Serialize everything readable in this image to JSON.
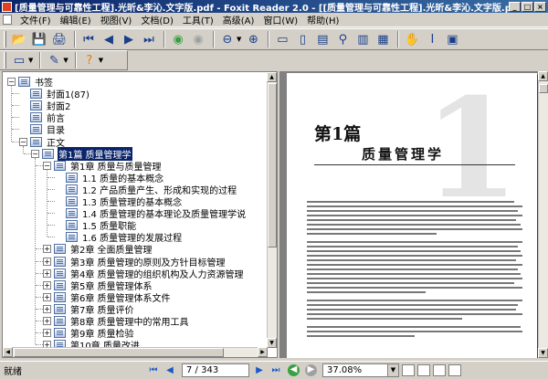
{
  "window": {
    "title": "[质量管理与可靠性工程].光昕&李沁.文字版.pdf - Foxit Reader 2.0 - [[质量管理与可靠性工程].光昕&李沁.文字版.pdf]",
    "buttons": {
      "minimize": "_",
      "maximize": "□",
      "close": "×"
    }
  },
  "menu": {
    "items": [
      {
        "label": "文件(F)"
      },
      {
        "label": "编辑(E)"
      },
      {
        "label": "视图(V)"
      },
      {
        "label": "文档(D)"
      },
      {
        "label": "工具(T)"
      },
      {
        "label": "高级(A)"
      },
      {
        "label": "窗口(W)"
      },
      {
        "label": "帮助(H)"
      }
    ]
  },
  "toolbar": {
    "icons": {
      "open": "folder-open-icon",
      "save": "save-icon",
      "print": "print-icon",
      "first": "first-page-icon",
      "prev": "previous-page-icon",
      "next": "next-page-icon",
      "last": "last-page-icon",
      "back": "back-icon",
      "forward": "forward-icon",
      "zoom_out": "zoom-out-icon",
      "zoom_in": "zoom-in-icon",
      "hand": "hand-tool-icon",
      "select_text": "select-text-icon",
      "snapshot": "snapshot-icon"
    },
    "glyphs": {
      "open": "📂",
      "save": "💾",
      "print": "🖨",
      "first": "⏮",
      "prev": "◀",
      "next": "▶",
      "last": "⏭",
      "back": "◉",
      "forward": "◉",
      "zoom_out": "⊖",
      "zoom_in": "⊕",
      "fit1": "▭",
      "fit2": "▯",
      "fit3": "▤",
      "fit4": "▥",
      "fit5": "▦",
      "find": "⚲",
      "hand": "✋",
      "select_text": "Ⅰ",
      "snapshot": "▣",
      "annot": "✎",
      "help": "?"
    }
  },
  "bookmarks": {
    "items": [
      {
        "label": "书签",
        "level": 0,
        "expand": "−",
        "selected": false
      },
      {
        "label": "封面1(87)",
        "level": 1,
        "expand": "",
        "selected": false
      },
      {
        "label": "封面2",
        "level": 1,
        "expand": "",
        "selected": false
      },
      {
        "label": "前言",
        "level": 1,
        "expand": "",
        "selected": false
      },
      {
        "label": "目录",
        "level": 1,
        "expand": "",
        "selected": false
      },
      {
        "label": "正文",
        "level": 1,
        "expand": "−",
        "selected": false
      },
      {
        "label": "第1篇 质量管理学",
        "level": 2,
        "expand": "−",
        "selected": true
      },
      {
        "label": "第1章 质量与质量管理",
        "level": 3,
        "expand": "−",
        "selected": false
      },
      {
        "label": "1.1 质量的基本概念",
        "level": 4,
        "expand": "",
        "selected": false
      },
      {
        "label": "1.2 产品质量产生、形成和实现的过程",
        "level": 4,
        "expand": "",
        "selected": false
      },
      {
        "label": "1.3 质量管理的基本概念",
        "level": 4,
        "expand": "",
        "selected": false
      },
      {
        "label": "1.4 质量管理的基本理论及质量管理学说",
        "level": 4,
        "expand": "",
        "selected": false
      },
      {
        "label": "1.5 质量职能",
        "level": 4,
        "expand": "",
        "selected": false
      },
      {
        "label": "1.6 质量管理的发展过程",
        "level": 4,
        "expand": "",
        "selected": false
      },
      {
        "label": "第2章 全面质量管理",
        "level": 3,
        "expand": "+",
        "selected": false
      },
      {
        "label": "第3章 质量管理的原则及方针目标管理",
        "level": 3,
        "expand": "+",
        "selected": false
      },
      {
        "label": "第4章 质量管理的组织机构及人力资源管理",
        "level": 3,
        "expand": "+",
        "selected": false
      },
      {
        "label": "第5章 质量管理体系",
        "level": 3,
        "expand": "+",
        "selected": false
      },
      {
        "label": "第6章 质量管理体系文件",
        "level": 3,
        "expand": "+",
        "selected": false
      },
      {
        "label": "第7章 质量评价",
        "level": 3,
        "expand": "+",
        "selected": false
      },
      {
        "label": "第8章 质量管理中的常用工具",
        "level": 3,
        "expand": "+",
        "selected": false
      },
      {
        "label": "第9章 质量检验",
        "level": 3,
        "expand": "+",
        "selected": false
      },
      {
        "label": "第10章 质量改进",
        "level": 3,
        "expand": "+",
        "selected": false
      }
    ]
  },
  "document": {
    "part_label": "第1篇",
    "big_number": "1",
    "part_title": "质量管理学"
  },
  "status": {
    "text": "就绪",
    "page_field": "7 / 343",
    "zoom": "37.08%",
    "nav": {
      "first": "⏮",
      "prev": "◀",
      "next": "▶",
      "last": "⏭",
      "back": "◀",
      "forward": "▶"
    }
  },
  "colors": {
    "selection": "#0a246a",
    "back_button": "#3aa040",
    "forward_button": "#a0a0a0"
  }
}
